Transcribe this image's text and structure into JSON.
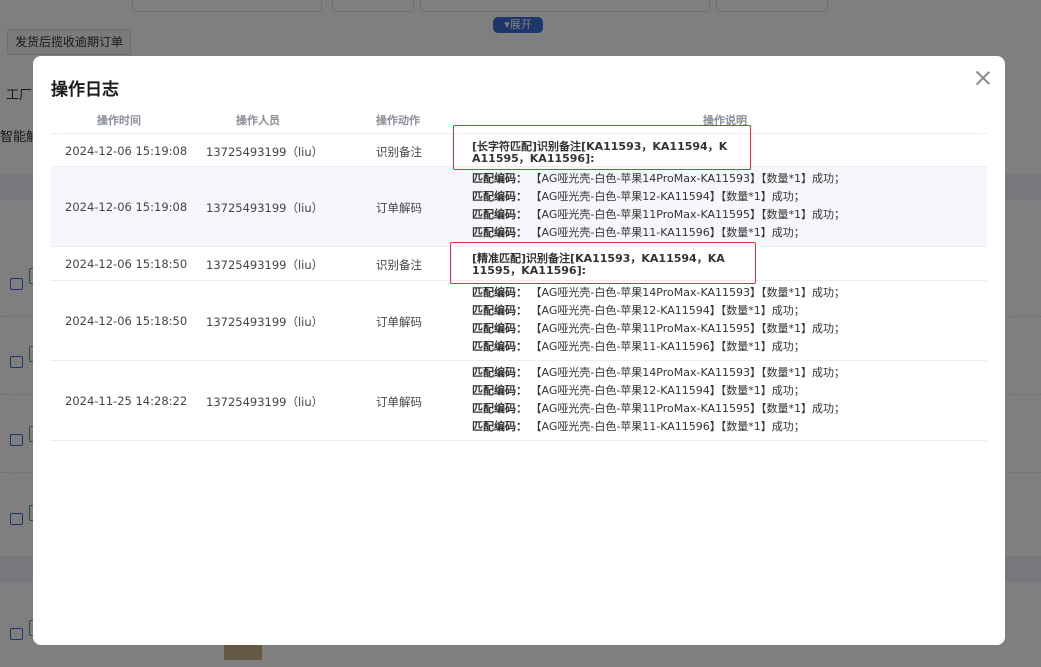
{
  "background": {
    "expand_label": "▾展开",
    "overdue_button": "发货后揽收逾期订单",
    "side_labels": [
      "工厂",
      "智能解"
    ]
  },
  "modal": {
    "title": "操作日志",
    "columns": [
      "操作时间",
      "操作人员",
      "操作动作",
      "操作说明"
    ],
    "rows": [
      {
        "time": "2024-12-06 15:19:08",
        "user": "13725493199（liu）",
        "action": "识别备注",
        "note": "[长字符匹配]识别备注[KA11593，KA11594，KA11595，KA11596]:"
      },
      {
        "time": "2024-12-06 15:19:08",
        "user": "13725493199（liu）",
        "action": "订单解码",
        "lines": [
          {
            "label": "匹配编码：",
            "text": "【AG哑光壳-白色-苹果14ProMax-KA11593】【数量*1】成功；"
          },
          {
            "label": "匹配编码：",
            "text": "【AG哑光壳-白色-苹果12-KA11594】【数量*1】成功；"
          },
          {
            "label": "匹配编码：",
            "text": "【AG哑光壳-白色-苹果11ProMax-KA11595】【数量*1】成功；"
          },
          {
            "label": "匹配编码：",
            "text": "【AG哑光壳-白色-苹果11-KA11596】【数量*1】成功；"
          }
        ]
      },
      {
        "time": "2024-12-06 15:18:50",
        "user": "13725493199（liu）",
        "action": "识别备注",
        "note": "[精准匹配]识别备注[KA11593，KA11594，KA11595，KA11596]:"
      },
      {
        "time": "2024-12-06 15:18:50",
        "user": "13725493199（liu）",
        "action": "订单解码",
        "lines": [
          {
            "label": "匹配编码：",
            "text": "【AG哑光壳-白色-苹果14ProMax-KA11593】【数量*1】成功；"
          },
          {
            "label": "匹配编码：",
            "text": "【AG哑光壳-白色-苹果12-KA11594】【数量*1】成功；"
          },
          {
            "label": "匹配编码：",
            "text": "【AG哑光壳-白色-苹果11ProMax-KA11595】【数量*1】成功；"
          },
          {
            "label": "匹配编码：",
            "text": "【AG哑光壳-白色-苹果11-KA11596】【数量*1】成功；"
          }
        ]
      },
      {
        "time": "2024-11-25 14:28:22",
        "user": "13725493199（liu）",
        "action": "订单解码",
        "lines": [
          {
            "label": "匹配编码：",
            "text": "【AG哑光壳-白色-苹果14ProMax-KA11593】【数量*1】成功；"
          },
          {
            "label": "匹配编码：",
            "text": "【AG哑光壳-白色-苹果12-KA11594】【数量*1】成功；"
          },
          {
            "label": "匹配编码：",
            "text": "【AG哑光壳-白色-苹果11ProMax-KA11595】【数量*1】成功；"
          },
          {
            "label": "匹配编码：",
            "text": "【AG哑光壳-白色-苹果11-KA11596】【数量*1】成功；"
          }
        ]
      }
    ]
  },
  "colors": {
    "highlight_border": "#e0303e",
    "accent": "#3a6fd8"
  }
}
